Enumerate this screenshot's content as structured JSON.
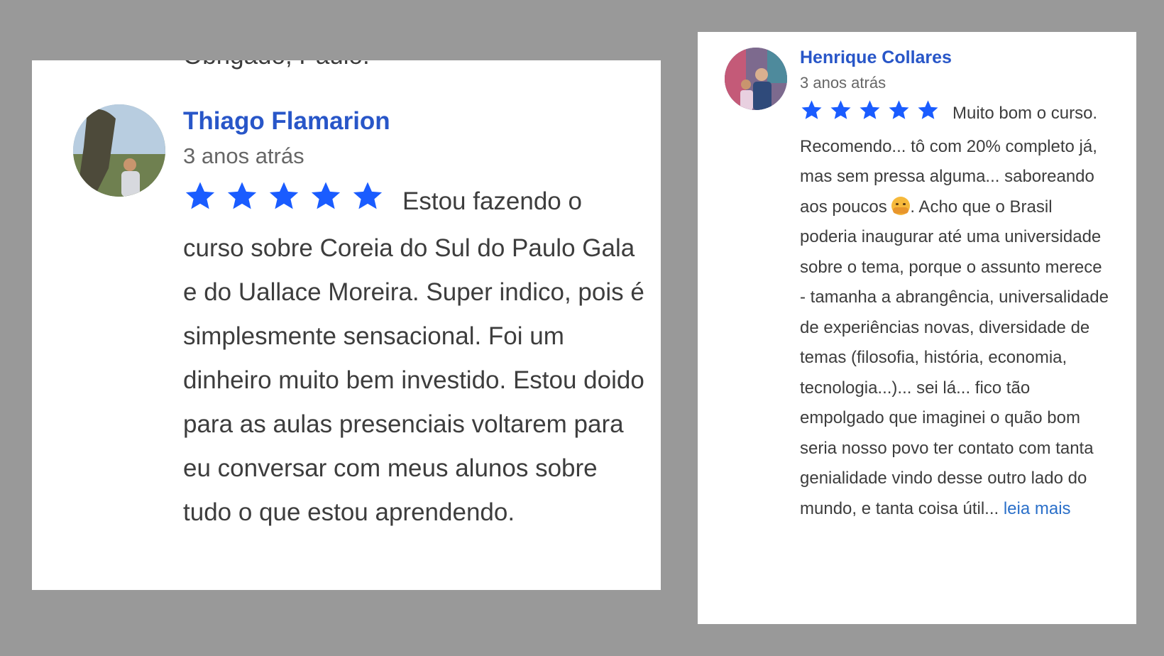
{
  "left_card": {
    "cut_off_text": "Obrigado, Paulo.",
    "author": "Thiago Flamarion",
    "time": "3 anos atrás",
    "rating": 5,
    "review": "Estou fazendo o curso sobre Coreia do Sul do Paulo Gala e do Uallace Moreira. Super indico, pois é simplesmente sensacional. Foi um dinheiro muito bem investido. Estou doido para as aulas presenciais voltarem para eu conversar com meus alunos sobre tudo o que estou aprendendo."
  },
  "right_card": {
    "author": "Henrique Collares",
    "time": "3 anos atrás",
    "rating": 5,
    "review_part1": "Muito bom o curso. Recomendo... tô com 20% completo já, mas sem pressa alguma... saboreando aos poucos ",
    "review_part2": ". Acho que o Brasil poderia inaugurar até uma universidade sobre o tema, porque o assunto merece - tamanha a abrangência, universalidade de experiências novas, diversidade de temas (filosofia, história, economia, tecnologia...)... sei lá... fico tão empolgado que imaginei o quão bom seria nosso povo ter contato com tanta genialidade vindo desse outro lado do mundo, e tanta coisa útil... ",
    "emoji": "hugging-face-emoji",
    "read_more": "leia mais"
  },
  "colors": {
    "background": "#999999",
    "card": "#ffffff",
    "author": "#2856c8",
    "star": "#1a5cff",
    "link": "#2a6fc9"
  },
  "icons": {
    "star": "star-icon",
    "avatar": "avatar"
  }
}
